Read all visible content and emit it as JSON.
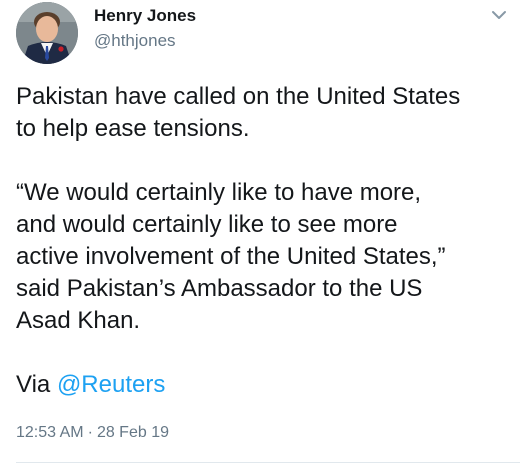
{
  "author": {
    "name": "Henry Jones",
    "handle": "@hthjones"
  },
  "tweet": {
    "lines_para1": [
      "Pakistan have called on the United States",
      "to help ease tensions."
    ],
    "lines_para2": [
      "“We would certainly like to have more,",
      "and would certainly like to see more",
      "active involvement of the United States,”",
      "said Pakistan’s Ambassador to the US",
      "Asad Khan."
    ],
    "via_text": "Via",
    "via_mention": "@Reuters"
  },
  "meta": {
    "time": "12:53 AM",
    "separator": "·",
    "date": "28 Feb 19"
  },
  "colors": {
    "link": "#1da1f2",
    "secondary_text": "#657786",
    "primary_text": "#14171a"
  },
  "icons": {
    "caret": "chevron-down-icon"
  }
}
